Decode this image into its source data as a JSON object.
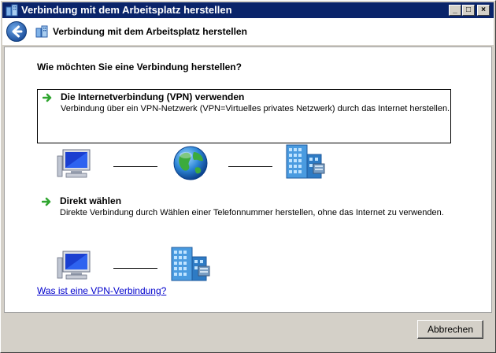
{
  "window": {
    "title": "Verbindung mit dem Arbeitsplatz herstellen",
    "controls": {
      "minimize": "_",
      "maximize": "□",
      "close": "×"
    }
  },
  "header": {
    "title": "Verbindung mit dem Arbeitsplatz herstellen",
    "back_icon": "back-arrow-icon",
    "app_icon": "workplace-connection-icon"
  },
  "main": {
    "question": "Wie möchten Sie eine Verbindung herstellen?",
    "options": [
      {
        "title": "Die Internetverbindung (VPN) verwenden",
        "description": "Verbindung über ein VPN-Netzwerk (VPN=Virtuelles privates Netzwerk) durch das Internet herstellen.",
        "icon": "green-arrow-icon",
        "selected": true,
        "diagram": [
          "computer-icon",
          "globe-icon",
          "office-building-icon"
        ]
      },
      {
        "title": "Direkt wählen",
        "description": "Direkte Verbindung durch Wählen einer Telefonnummer herstellen, ohne das Internet zu verwenden.",
        "icon": "green-arrow-icon",
        "selected": false,
        "diagram": [
          "computer-icon",
          "office-building-icon"
        ]
      }
    ],
    "help_link": "Was ist eine VPN-Verbindung?"
  },
  "footer": {
    "cancel_label": "Abbrechen"
  },
  "colors": {
    "titlebar": "#0a246a",
    "window_face": "#d4d0c8",
    "link": "#0000cc",
    "arrow_green": "#2fa52f"
  }
}
